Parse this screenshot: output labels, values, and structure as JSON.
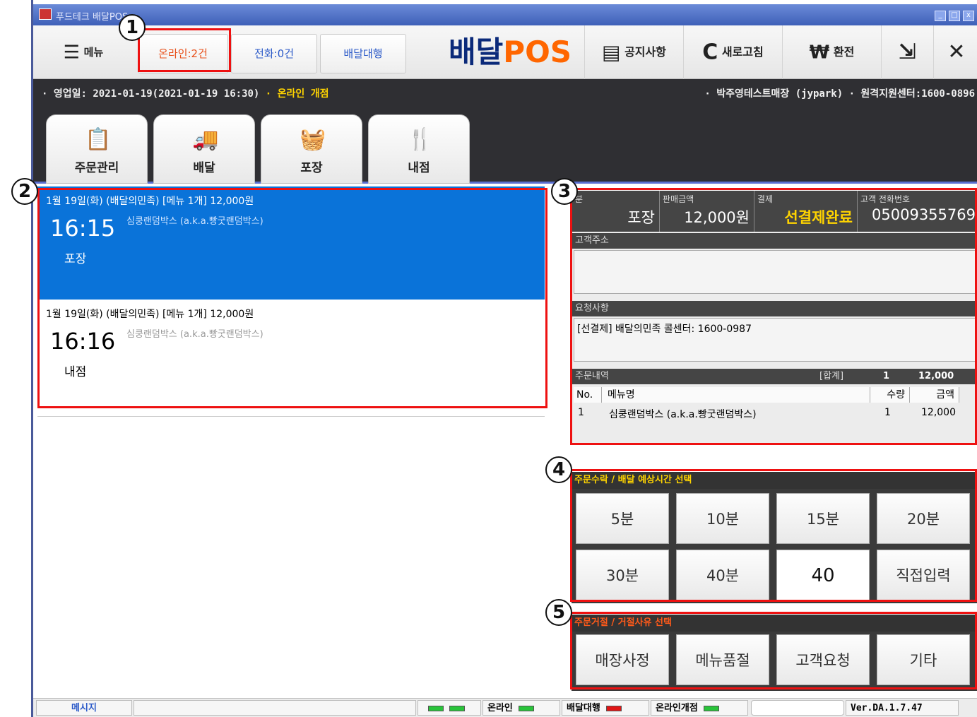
{
  "window": {
    "title": "푸드테크 배달POS"
  },
  "toolbar": {
    "menu_label": "메뉴",
    "online_label": "온라인:2건",
    "phone_label": "전화:0건",
    "delivery_agency_label": "배달대행",
    "brand_main": "배달",
    "brand_accent": "POS",
    "notice_label": "공지사항",
    "refresh_label": "새로고침",
    "exchange_label": "환전",
    "exchange_symbol": "₩",
    "refresh_symbol": "C",
    "close_symbol": "✕"
  },
  "info": {
    "business_day": "· 영업일: 2021-01-19(2021-01-19 16:30)",
    "online_status": "· 온라인 개점",
    "store": "· 박주영테스트매장 (jypark)  · 원격지원센터:1600-0896"
  },
  "tabs": [
    {
      "label": "주문관리",
      "icon": "clipboard-icon"
    },
    {
      "label": "배달",
      "icon": "truck-icon"
    },
    {
      "label": "포장",
      "icon": "basket-icon"
    },
    {
      "label": "내점",
      "icon": "fork-icon"
    }
  ],
  "orders": [
    {
      "header": "1월 19일(화)  (배달의민족)  [메뉴 1개] 12,000원",
      "time": "16:15",
      "shop": "심쿵랜덤박스 (a.k.a.빵굿랜덤박스)",
      "type": "포장"
    },
    {
      "header": "1월 19일(화)  (배달의민족)  [메뉴 1개] 12,000원",
      "time": "16:16",
      "shop": "심쿵랜덤박스 (a.k.a.빵굿랜덤박스)",
      "type": "내점"
    }
  ],
  "detail": {
    "col1_label": "분",
    "col1_value": "포장",
    "col2_label": "판매금액",
    "col2_value": "12,000원",
    "col3_label": "결제",
    "col3_value": "선결제완료",
    "col4_label": "고객 전화번호",
    "col4_value": "05009355769",
    "address_label": "고객주소",
    "address_value": "",
    "request_label": "요청사항",
    "request_value": "[선결제] 배달의민족 콜센터: 1600-0987",
    "items_label": "주문내역",
    "total_label": "[합계]",
    "total_qty": "1",
    "total_amount": "12,000",
    "table_headers": [
      "No.",
      "메뉴명",
      "수량",
      "금액"
    ],
    "rows": [
      {
        "no": "1",
        "name": "심쿵랜덤박스 (a.k.a.빵굿랜덤박스)",
        "qty": "1",
        "amount": "12,000"
      }
    ]
  },
  "accept": {
    "label": "주문수락 / 배달 예상시간 선택",
    "buttons": [
      "5분",
      "10분",
      "15분",
      "20분",
      "30분",
      "40분",
      "40",
      "직접입력"
    ]
  },
  "reject": {
    "label": "주문거절 / 거절사유 선택",
    "buttons": [
      "매장사정",
      "메뉴품절",
      "고객요청",
      "기타"
    ]
  },
  "annotations": [
    "1",
    "2",
    "3",
    "4",
    "5"
  ],
  "status": {
    "message_label": "메시지",
    "online_label": "온라인",
    "agency_label": "배달대행",
    "online_open_label": "온라인개점",
    "version": "Ver.DA.1.7.47"
  },
  "colors": {
    "selected_order": "#0a73d9",
    "accept_label": "#ffd400",
    "reject_label": "#ff5a1a",
    "annotation": "#e11111",
    "brand_navy": "#0b2a7a",
    "brand_orange": "#ff6600"
  }
}
